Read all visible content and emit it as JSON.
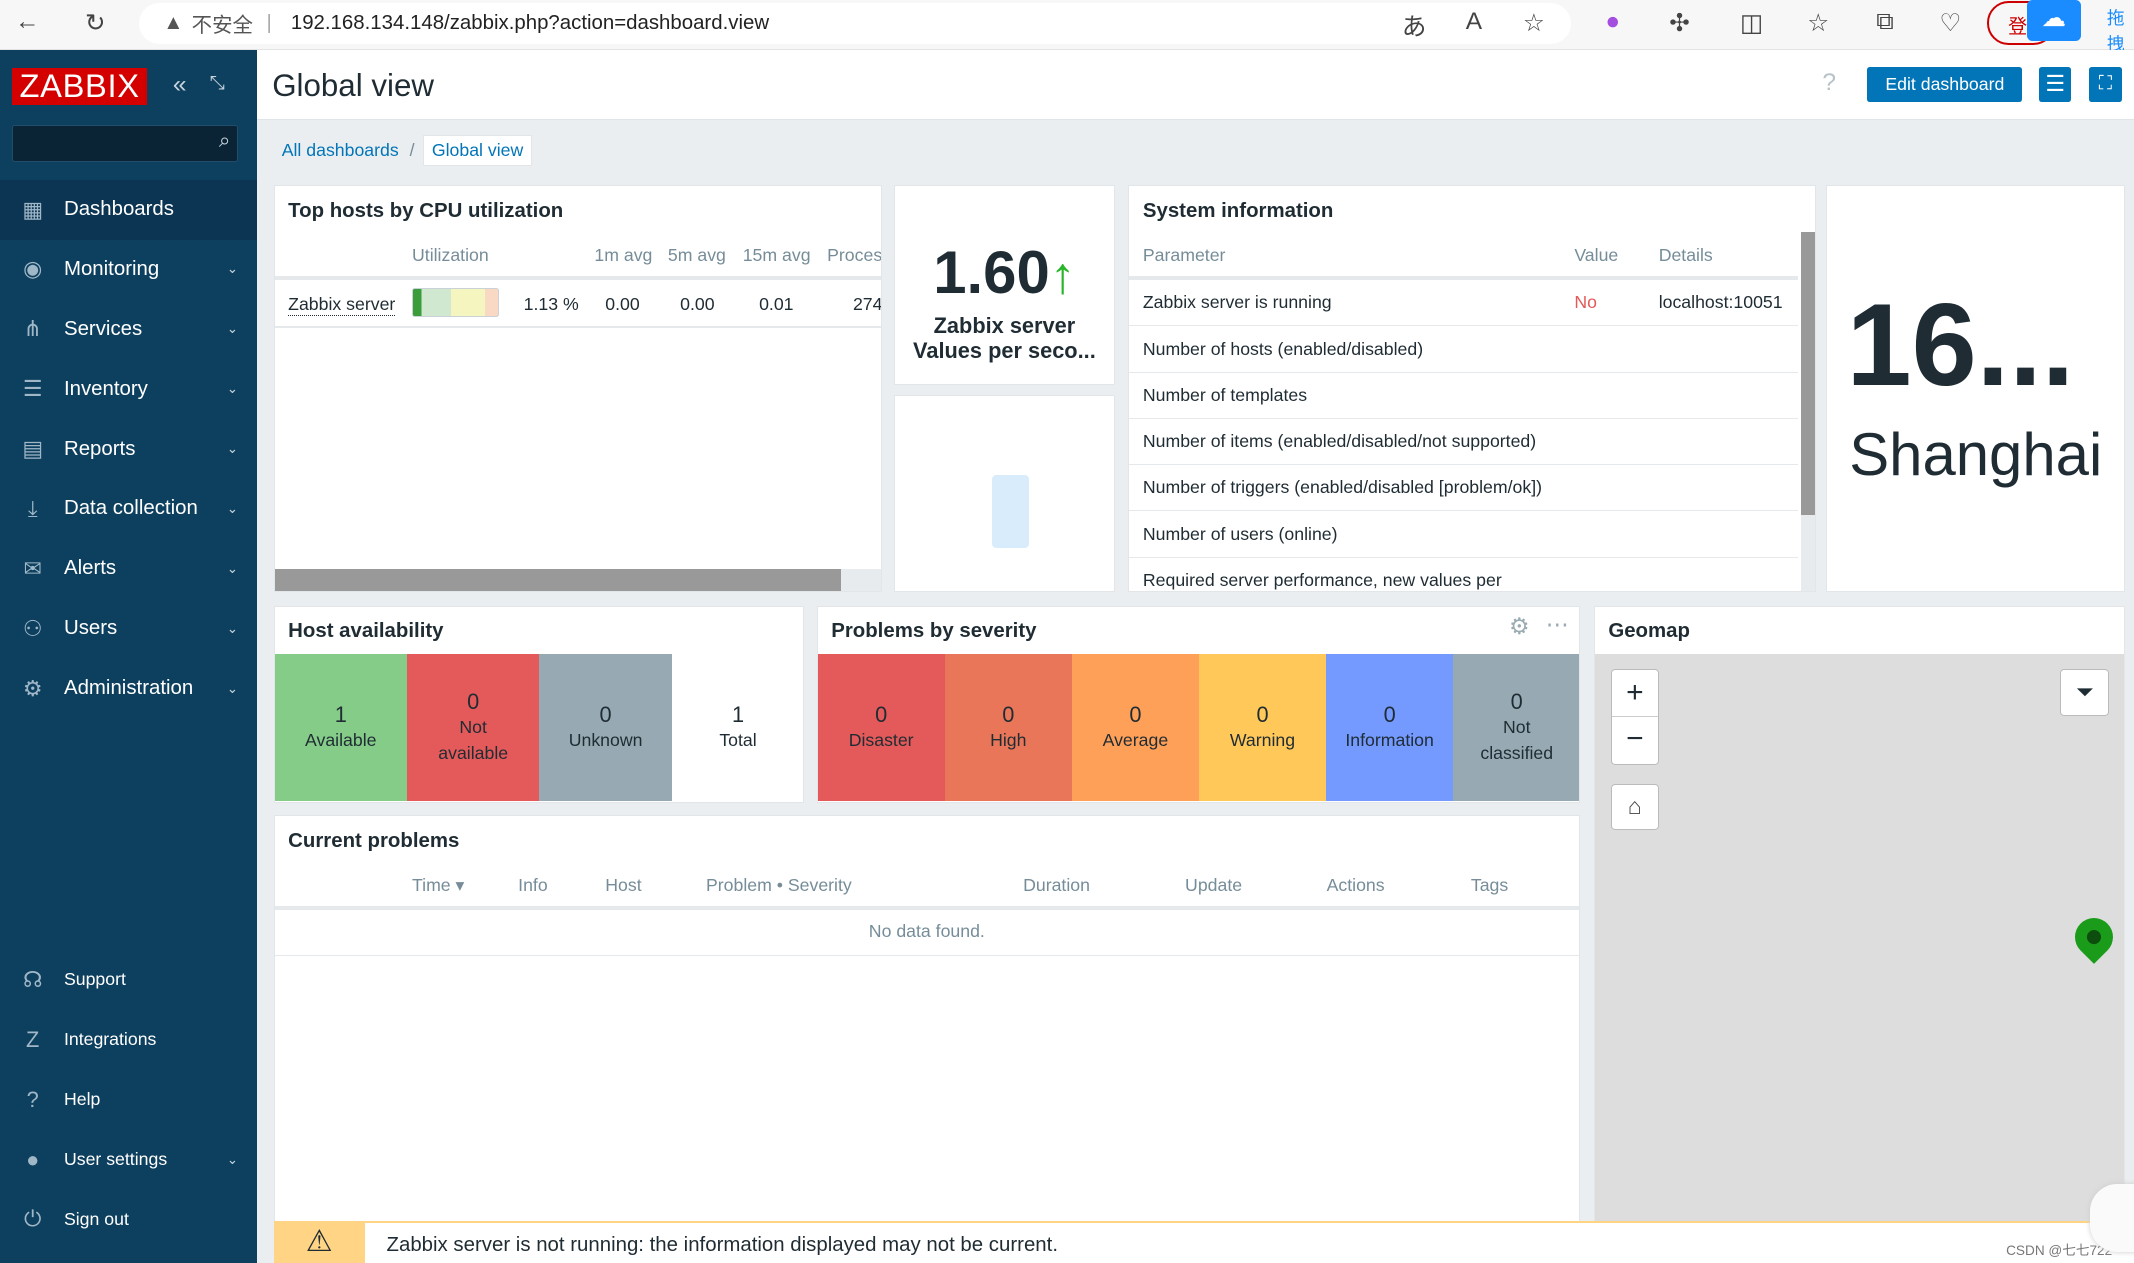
{
  "browser": {
    "insecure_label": "不安全",
    "url": "192.168.134.148/zabbix.php?action=dashboard.view",
    "login_label": "登",
    "right_label": "拖拽"
  },
  "sidebar": {
    "logo": "ZABBIX",
    "items": [
      {
        "label": "Dashboards",
        "icon": "dashboard-icon"
      },
      {
        "label": "Monitoring",
        "icon": "eye-icon"
      },
      {
        "label": "Services",
        "icon": "services-icon"
      },
      {
        "label": "Inventory",
        "icon": "list-icon"
      },
      {
        "label": "Reports",
        "icon": "report-icon"
      },
      {
        "label": "Data collection",
        "icon": "download-icon"
      },
      {
        "label": "Alerts",
        "icon": "mail-icon"
      },
      {
        "label": "Users",
        "icon": "users-icon"
      },
      {
        "label": "Administration",
        "icon": "gear-icon"
      }
    ],
    "bottom": [
      {
        "label": "Support",
        "icon": "headset-icon"
      },
      {
        "label": "Integrations",
        "icon": "z-icon"
      },
      {
        "label": "Help",
        "icon": "question-icon"
      },
      {
        "label": "User settings",
        "icon": "user-icon"
      },
      {
        "label": "Sign out",
        "icon": "power-icon"
      }
    ]
  },
  "header": {
    "title": "Global view",
    "edit_label": "Edit dashboard",
    "help": "?"
  },
  "breadcrumb": {
    "all": "All dashboards",
    "sep": "/",
    "current": "Global view"
  },
  "top_hosts": {
    "title": "Top hosts by CPU utilization",
    "headers": [
      "Utilization",
      "1m avg",
      "5m avg",
      "15m avg",
      "Proces"
    ],
    "row": {
      "host": "Zabbix server",
      "util": "1.13 %",
      "avg1": "0.00",
      "avg5": "0.00",
      "avg15": "0.01",
      "proc": "274"
    },
    "util_fraction": 0.0113
  },
  "item_value": {
    "value": "1.60",
    "trend": "up",
    "line1": "Zabbix server",
    "line2": "Values per seco..."
  },
  "system_info": {
    "title": "System information",
    "headers": [
      "Parameter",
      "Value",
      "Details"
    ],
    "rows": [
      [
        "Zabbix server is running",
        "No",
        "localhost:10051"
      ],
      [
        "Number of hosts (enabled/disabled)",
        "",
        ""
      ],
      [
        "Number of templates",
        "",
        ""
      ],
      [
        "Number of items (enabled/disabled/not supported)",
        "",
        ""
      ],
      [
        "Number of triggers (enabled/disabled [problem/ok])",
        "",
        ""
      ],
      [
        "Number of users (online)",
        "",
        ""
      ],
      [
        "Required server performance, new values per",
        "",
        ""
      ]
    ]
  },
  "clock": {
    "time": "16...",
    "city": "Shanghai"
  },
  "host_availability": {
    "title": "Host availability",
    "cells": [
      {
        "n": "1",
        "label": "Available",
        "color": "#86cc89"
      },
      {
        "n": "0",
        "label": "Not available",
        "color": "#e45959"
      },
      {
        "n": "0",
        "label": "Unknown",
        "color": "#97aab3"
      },
      {
        "n": "1",
        "label": "Total",
        "color": "#ffffff"
      }
    ]
  },
  "problems_severity": {
    "title": "Problems by severity",
    "cells": [
      {
        "n": "0",
        "label": "Disaster",
        "color": "#e45959"
      },
      {
        "n": "0",
        "label": "High",
        "color": "#e97659"
      },
      {
        "n": "0",
        "label": "Average",
        "color": "#ffa059"
      },
      {
        "n": "0",
        "label": "Warning",
        "color": "#ffc859"
      },
      {
        "n": "0",
        "label": "Information",
        "color": "#7499ff"
      },
      {
        "n": "0",
        "label": "Not classified",
        "color": "#97aab3"
      }
    ]
  },
  "geomap": {
    "title": "Geomap",
    "zoom_in": "+",
    "zoom_out": "−"
  },
  "current_problems": {
    "title": "Current problems",
    "headers": [
      "Time ▾",
      "Info",
      "Host",
      "Problem • Severity",
      "Duration",
      "Update",
      "Actions",
      "Tags"
    ],
    "empty": "No data found."
  },
  "notice": {
    "text": "Zabbix server is not running: the information displayed may not be current."
  },
  "watermark": "CSDN @七七722"
}
